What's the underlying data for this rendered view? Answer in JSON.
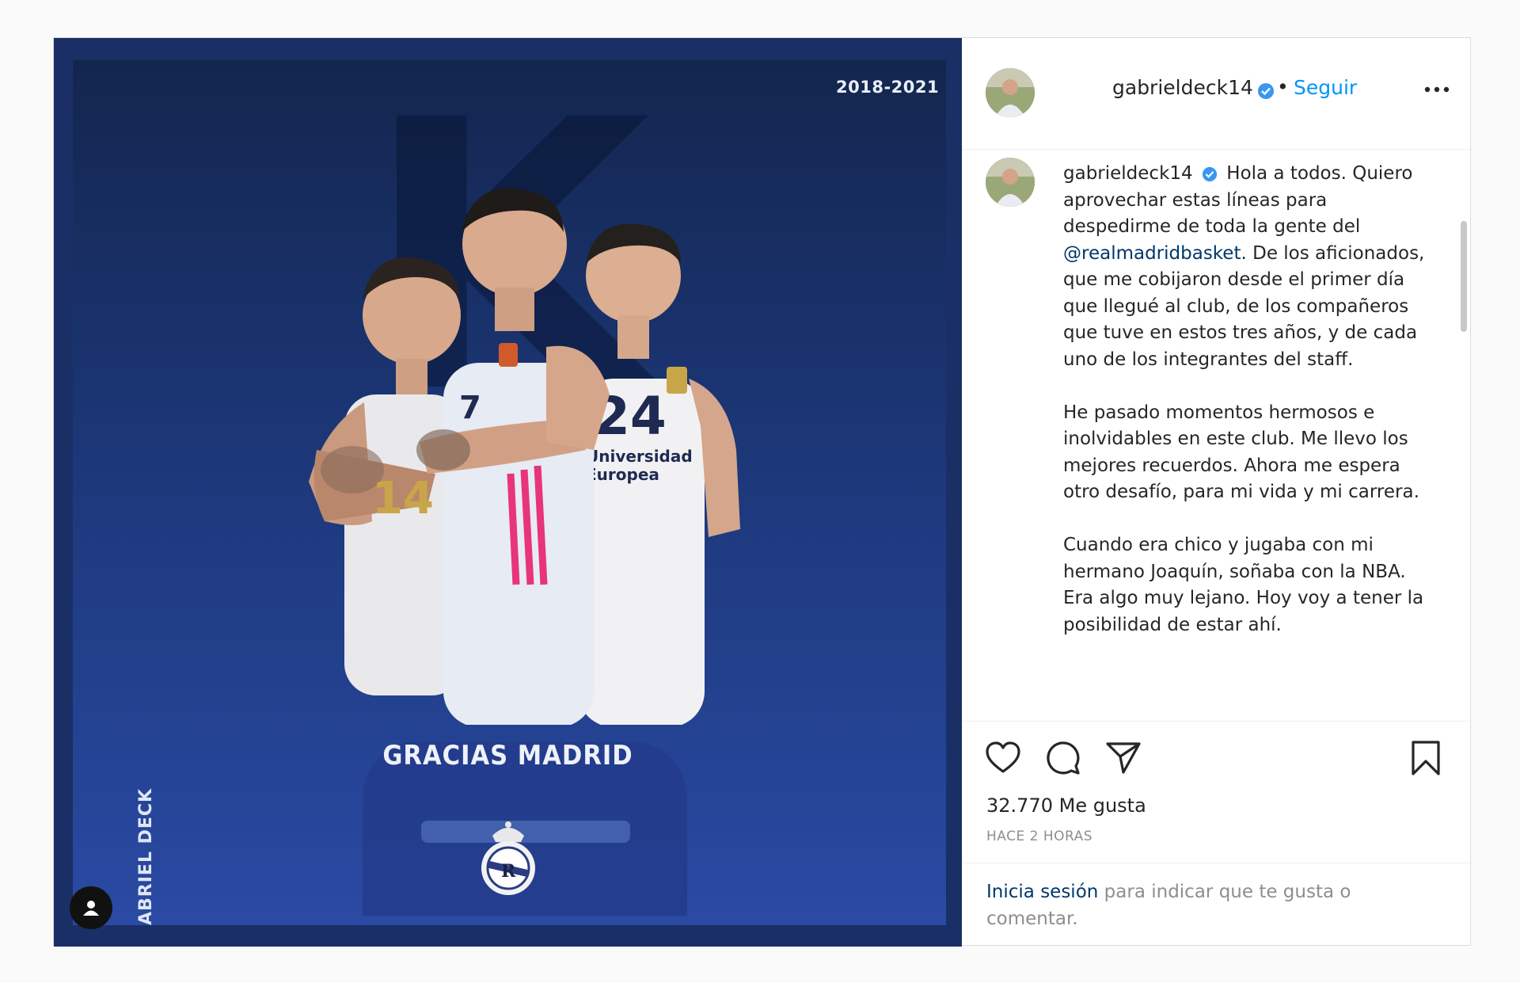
{
  "media": {
    "years": "2018-2021",
    "headline": "GRACIAS MADRID",
    "vertical_name": "ABRIEL DECK",
    "jersey_numbers": [
      "14",
      "7",
      "24"
    ],
    "sponsor_line1": "Universidad",
    "sponsor_line2": "Europea"
  },
  "header": {
    "username": "gabrieldeck14",
    "separator": "•",
    "follow_label": "Seguir"
  },
  "caption": {
    "username": "gabrieldeck14",
    "p1_start": "Hola a todos. Quiero aprovechar estas líneas para despedirme de toda la gente del ",
    "mention": "@realmadridbasket",
    "p1_end": ". De los aficionados, que me cobijaron desde el primer día que llegué al club, de los compañeros que tuve en estos tres años, y de cada uno de los integrantes del staff.",
    "p2": "He pasado momentos hermosos e inolvidables en este club. Me llevo los mejores recuerdos. Ahora me espera otro desafío, para mi vida y mi carrera.",
    "p3": "Cuando era chico y jugaba con mi hermano Joaquín, soñaba con la NBA. Era algo muy lejano. Hoy voy a tener la posibilidad de estar ahí."
  },
  "actions": {
    "likes": "32.770 Me gusta",
    "time": "HACE 2 HORAS"
  },
  "login": {
    "link": "Inicia sesión",
    "text": " para indicar que te gusta o comentar."
  },
  "colors": {
    "accent": "#0095f6",
    "mention": "#00376b",
    "muted": "#8e8e8e",
    "verified": "#3897f0",
    "media_bg": "#1c3778"
  },
  "icons": [
    "heart-icon",
    "comment-icon",
    "share-icon",
    "bookmark-icon",
    "more-icon",
    "verified-icon",
    "user-tag-icon"
  ]
}
